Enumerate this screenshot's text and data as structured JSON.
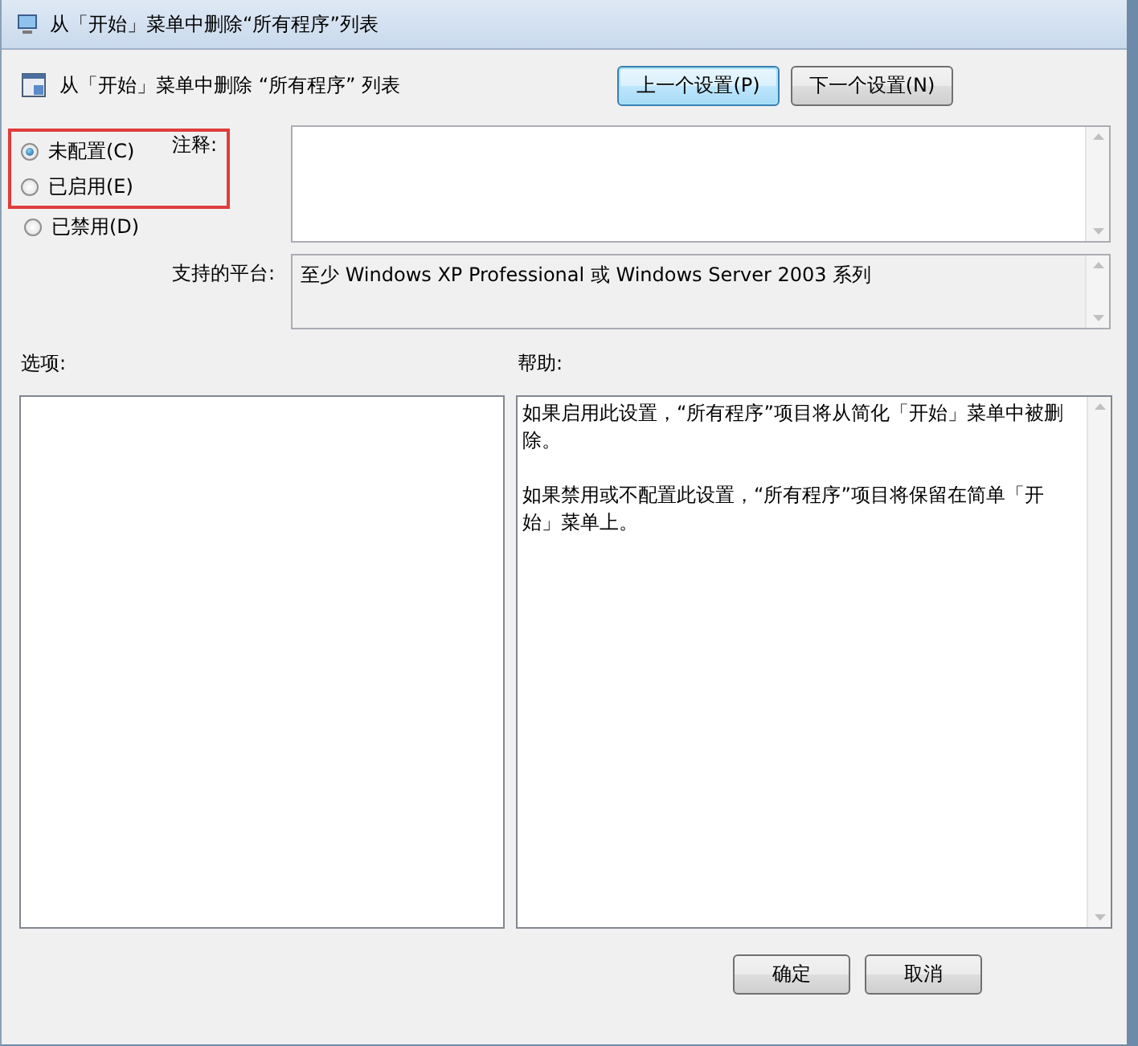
{
  "window": {
    "title": "从「开始」菜单中删除“所有程序”列表"
  },
  "header": {
    "title": "从「开始」菜单中删除 “所有程序” 列表"
  },
  "nav_buttons": [
    {
      "label": "上一个设置(P)",
      "focused": true
    },
    {
      "label": "下一个设置(N)",
      "focused": false
    }
  ],
  "radios": [
    {
      "label": "未配置(C)",
      "selected": true,
      "highlighted": true
    },
    {
      "label": "已启用(E)",
      "selected": false,
      "highlighted": true
    },
    {
      "label": "已禁用(D)",
      "selected": false,
      "highlighted": false
    }
  ],
  "comment": {
    "label": "注释:"
  },
  "platform": {
    "label": "支持的平台:",
    "value": "至少 Windows XP Professional 或 Windows Server 2003 系列"
  },
  "options": {
    "label": "选项:"
  },
  "help": {
    "label": "帮助:",
    "paragraphs": [
      "如果启用此设置，“所有程序”项目将从简化「开始」菜单中被删除。",
      "如果禁用或不配置此设置，“所有程序”项目将保留在简单「开始」菜单上。"
    ]
  },
  "buttons": [
    {
      "label": "确定"
    },
    {
      "label": "取消"
    }
  ]
}
